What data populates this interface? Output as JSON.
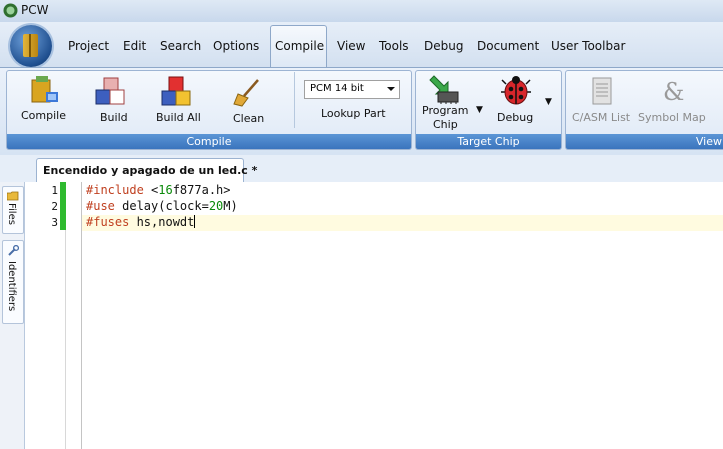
{
  "window": {
    "title": "PCW"
  },
  "menu": {
    "items": [
      "Project",
      "Edit",
      "Search",
      "Options",
      "Compile",
      "View",
      "Tools",
      "Debug",
      "Document",
      "User Toolbar"
    ],
    "active": "Compile"
  },
  "ribbon": {
    "compile_group": {
      "label": "Compile",
      "buttons": [
        "Compile",
        "Build",
        "Build All",
        "Clean"
      ],
      "target_select": "PCM 14 bit",
      "lookup_part": "Lookup Part"
    },
    "target_group": {
      "label": "Target Chip",
      "program_chip_line1": "Program",
      "program_chip_line2": "Chip",
      "debug": "Debug"
    },
    "view_group": {
      "label": "View",
      "buttons": [
        "C/ASM List",
        "Symbol Map"
      ]
    }
  },
  "editor": {
    "tab": "Encendido y apagado de un led.c *",
    "side_tabs": [
      "Files",
      "Identifiers"
    ],
    "line_numbers": [
      "1",
      "2",
      "3"
    ],
    "lines": [
      {
        "directive": "#include",
        "rest_pre": " <",
        "num": "16",
        "rest_post": "f877a.h>"
      },
      {
        "directive": "#use",
        "rest_pre": " delay(clock=",
        "num": "20",
        "rest_post": "M)"
      },
      {
        "directive": "#fuses",
        "rest_pre": " hs,nowdt",
        "num": "",
        "rest_post": ""
      }
    ]
  }
}
